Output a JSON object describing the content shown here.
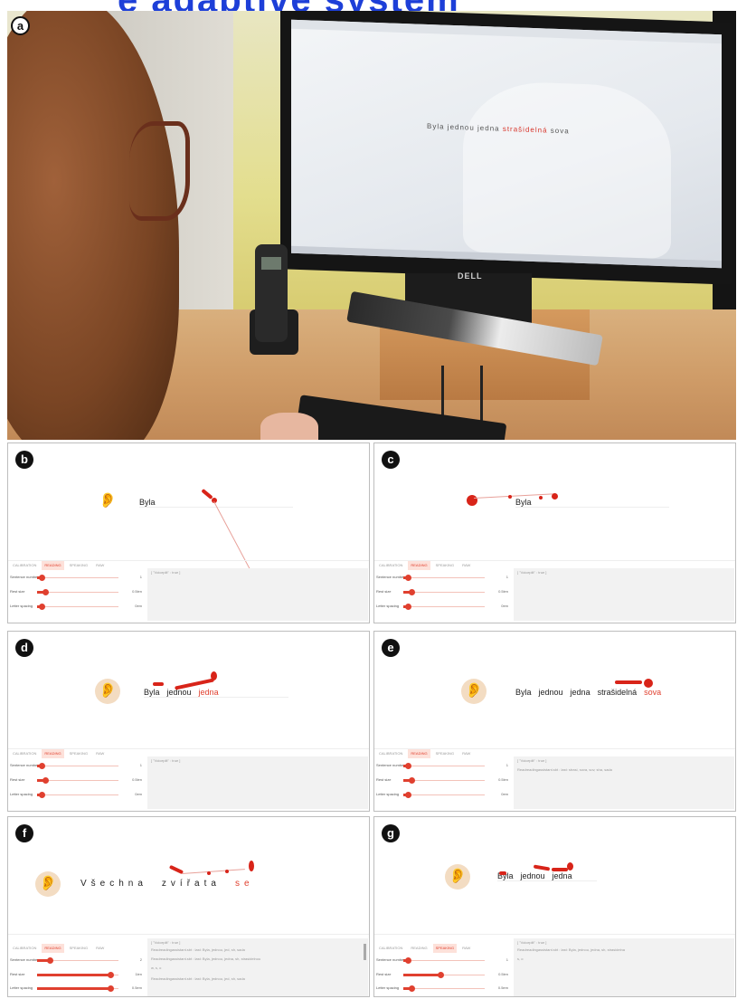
{
  "banner_text": "e adaptive system",
  "panel_labels": [
    "a",
    "b",
    "c",
    "d",
    "e",
    "f",
    "g"
  ],
  "photo": {
    "screen_text": {
      "pre": "Byla jednou jedna ",
      "highlight": "strašidelná",
      "post": " sova"
    },
    "monitor_brand": "DELL"
  },
  "panels": {
    "b": {
      "tabs": [
        "CALIBRATION",
        "READING",
        "SPEAKING",
        "RAW"
      ],
      "active_tab": 1,
      "words": [
        "Byla"
      ],
      "highlight_index": -1,
      "sliders": [
        {
          "label": "Sentence number",
          "value": "1",
          "level": 0.05
        },
        {
          "label": "Rest size",
          "value": "0.5len",
          "level": 0.1
        },
        {
          "label": "Letter spacing",
          "value": "0em",
          "level": 0.05
        }
      ],
      "log_header": "[ \"Voiceplit\" : true ]",
      "log_lines": []
    },
    "c": {
      "tabs": [
        "CALIBRATION",
        "READING",
        "SPEAKING",
        "RAW"
      ],
      "active_tab": 1,
      "words": [
        "Byla"
      ],
      "highlight_index": -1,
      "sliders": [
        {
          "label": "Sentence number",
          "value": "1",
          "level": 0.05
        },
        {
          "label": "Rest size",
          "value": "0.5len",
          "level": 0.1
        },
        {
          "label": "Letter spacing",
          "value": "0em",
          "level": 0.05
        }
      ],
      "log_header": "[ \"Voiceplit\" : true ]",
      "log_lines": []
    },
    "d": {
      "tabs": [
        "CALIBRATION",
        "READING",
        "SPEAKING",
        "RAW"
      ],
      "active_tab": 1,
      "words": [
        "Byla",
        "jednou",
        "jedna"
      ],
      "highlight_index": 2,
      "sliders": [
        {
          "label": "Sentence number",
          "value": "1",
          "level": 0.05
        },
        {
          "label": "Rest size",
          "value": "0.5len",
          "level": 0.1
        },
        {
          "label": "Letter spacing",
          "value": "0em",
          "level": 0.05
        }
      ],
      "log_header": "[ \"Voiceplit\" : true ]",
      "log_lines": []
    },
    "e": {
      "tabs": [
        "CALIBRATION",
        "READING",
        "SPEAKING",
        "RAW"
      ],
      "active_tab": 1,
      "words": [
        "Byla",
        "jednou",
        "jedna",
        "strašidelná",
        "sova"
      ],
      "highlight_index": 4,
      "sliders": [
        {
          "label": "Sentence number",
          "value": "1",
          "level": 0.05
        },
        {
          "label": "Rest size",
          "value": "0.5len",
          "level": 0.1
        },
        {
          "label": "Letter spacing",
          "value": "0em",
          "level": 0.05
        }
      ],
      "log_header": "[ \"Voiceplit\" : true ]",
      "log_lines": [
        "Readreadingassistant.sbt : last: strasi, sova, sov, sha, sada"
      ]
    },
    "f": {
      "tabs": [
        "CALIBRATION",
        "READING",
        "SPEAKING",
        "RAW"
      ],
      "active_tab": 1,
      "words": [
        "Všechna",
        "zvířata",
        "se"
      ],
      "highlight_index": 2,
      "sliders": [
        {
          "label": "Sentence number",
          "value": "2",
          "level": 0.15
        },
        {
          "label": "Rest size",
          "value": "1len",
          "level": 0.9
        },
        {
          "label": "Letter spacing",
          "value": "0.5em",
          "level": 0.9
        }
      ],
      "log_header": "[ \"Voiceplit\" : true ]",
      "log_lines": [
        "Readreadingassistant.sbt : last: Byla, jednou, jed, sh, sada",
        "Readreadingassistant.sbt : last: Byla, jednou, jedna, sh, strasidelnou",
        "w, s, o",
        "Readreadingassistant.sbt : last: Byla, jednou, jed, sh, sada"
      ]
    },
    "g": {
      "tabs": [
        "CALIBRATION",
        "READING",
        "SPEAKING",
        "RAW"
      ],
      "active_tab": 2,
      "words": [
        "Byla",
        "jednou",
        "jedna"
      ],
      "highlight_index": -1,
      "sliders": [
        {
          "label": "Sentence number",
          "value": "1",
          "level": 0.05
        },
        {
          "label": "Rest size",
          "value": "0.5len",
          "level": 0.45
        },
        {
          "label": "Letter spacing",
          "value": "0.5em",
          "level": 0.1
        }
      ],
      "log_header": "[ \"Voiceplit\" : true ]",
      "log_lines": [
        "Readreadingassistant.sbt : last: Byla, jednou, jedna, sh, strasidelna",
        "s, o"
      ]
    }
  }
}
